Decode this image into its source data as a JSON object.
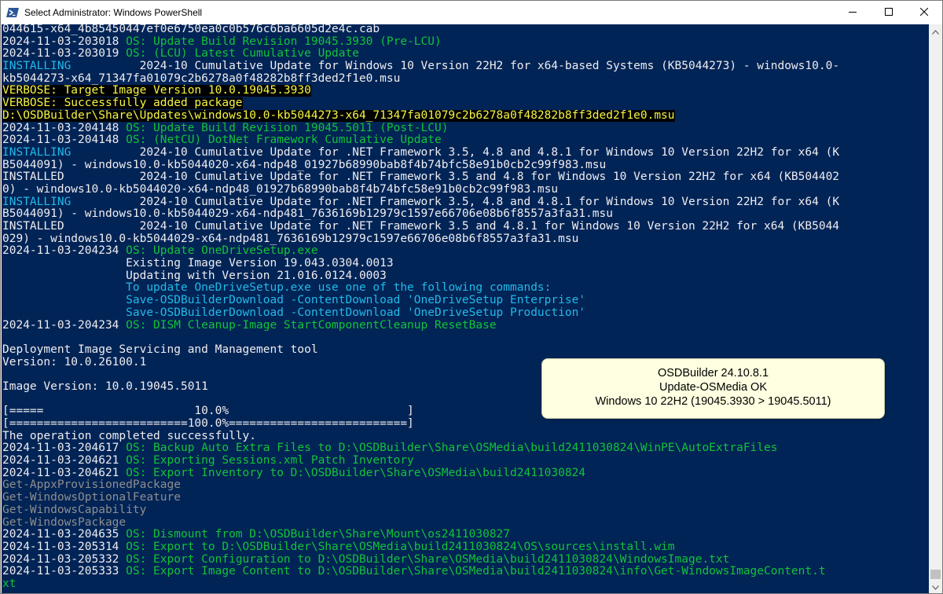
{
  "window": {
    "title": "Select Administrator: Windows PowerShell",
    "icon": "powershell-icon",
    "controls": [
      "minimize-icon",
      "maximize-icon",
      "close-icon"
    ]
  },
  "colors": {
    "console_bg": "#012456",
    "text_white": "#eeedf0",
    "text_green": "#13c23a",
    "text_cyan": "#23b9e8",
    "text_gray": "#8e8e8e",
    "verbose_yellow": "#f5f544",
    "verbose_bg": "#000000",
    "notification_bg": "#ffffe1"
  },
  "console": {
    "lines": [
      {
        "segments": [
          {
            "t": "044615-x64_4b85450447ef0e6750ea0c0b576c6ba6605d2e4c.cab",
            "c": "white"
          }
        ]
      },
      {
        "segments": [
          {
            "t": "2024-11-03-203018 ",
            "c": "white"
          },
          {
            "t": "OS: Update Build Revision 19045.3930 (Pre-LCU)",
            "c": "green"
          }
        ]
      },
      {
        "segments": [
          {
            "t": "2024-11-03-203019 ",
            "c": "white"
          },
          {
            "t": "OS: (LCU) Latest Cumulative Update",
            "c": "green"
          }
        ]
      },
      {
        "segments": [
          {
            "t": "INSTALLING          ",
            "c": "cyan"
          },
          {
            "t": "2024-10 Cumulative Update for Windows 10 Version 22H2 for x64-based Systems (KB5044273) - windows10.0-",
            "c": "white"
          }
        ]
      },
      {
        "segments": [
          {
            "t": "kb5044273-x64_71347fa01079c2b6278a0f48282b8ff3ded2f1e0.msu",
            "c": "white"
          }
        ]
      },
      {
        "segments": [
          {
            "t": "VERBOSE: Target Image Version 10.0.19045.3930",
            "c": "hl"
          }
        ]
      },
      {
        "segments": [
          {
            "t": "VERBOSE: Successfully added package",
            "c": "hl"
          }
        ]
      },
      {
        "segments": [
          {
            "t": "D:\\OSDBuilder\\Share\\Updates\\windows10.0-kb5044273-x64_71347fa01079c2b6278a0f48282b8ff3ded2f1e0.msu",
            "c": "hl"
          }
        ]
      },
      {
        "segments": [
          {
            "t": "2024-11-03-204148 ",
            "c": "white"
          },
          {
            "t": "OS: Update Build Revision 19045.5011 (Post-LCU)",
            "c": "green"
          }
        ]
      },
      {
        "segments": [
          {
            "t": "2024-11-03-204148 ",
            "c": "white"
          },
          {
            "t": "OS: (NetCU) DotNet Framework Cumulative Update",
            "c": "green"
          }
        ]
      },
      {
        "segments": [
          {
            "t": "INSTALLING          ",
            "c": "cyan"
          },
          {
            "t": "2024-10 Cumulative Update for .NET Framework 3.5, 4.8 and 4.8.1 for Windows 10 Version 22H2 for x64 (K",
            "c": "white"
          }
        ]
      },
      {
        "segments": [
          {
            "t": "B5044091) - windows10.0-kb5044020-x64-ndp48_01927b68990bab8f4b74bfc58e91b0cb2c99f983.msu",
            "c": "white"
          }
        ]
      },
      {
        "segments": [
          {
            "t": "INSTALLED           2024-10 Cumulative Update for .NET Framework 3.5 and 4.8 for Windows 10 Version 22H2 for x64 (KB504402",
            "c": "white"
          }
        ]
      },
      {
        "segments": [
          {
            "t": "0) - windows10.0-kb5044020-x64-ndp48_01927b68990bab8f4b74bfc58e91b0cb2c99f983.msu",
            "c": "white"
          }
        ]
      },
      {
        "segments": [
          {
            "t": "INSTALLING          ",
            "c": "cyan"
          },
          {
            "t": "2024-10 Cumulative Update for .NET Framework 3.5, 4.8 and 4.8.1 for Windows 10 Version 22H2 for x64 (K",
            "c": "white"
          }
        ]
      },
      {
        "segments": [
          {
            "t": "B5044091) - windows10.0-kb5044029-x64-ndp481_7636169b12979c1597e66706e08b6f8557a3fa31.msu",
            "c": "white"
          }
        ]
      },
      {
        "segments": [
          {
            "t": "INSTALLED           2024-10 Cumulative Update for .NET Framework 3.5 and 4.8.1 for Windows 10 Version 22H2 for x64 (KB5044",
            "c": "white"
          }
        ]
      },
      {
        "segments": [
          {
            "t": "029) - windows10.0-kb5044029-x64-ndp481_7636169b12979c1597e66706e08b6f8557a3fa31.msu",
            "c": "white"
          }
        ]
      },
      {
        "segments": [
          {
            "t": "2024-11-03-204234 ",
            "c": "white"
          },
          {
            "t": "OS: Update OneDriveSetup.exe",
            "c": "green"
          }
        ]
      },
      {
        "segments": [
          {
            "t": "                  Existing Image Version 19.043.0304.0013",
            "c": "white"
          }
        ]
      },
      {
        "segments": [
          {
            "t": "                  Updating with Version 21.016.0124.0003",
            "c": "white"
          }
        ]
      },
      {
        "segments": [
          {
            "t": "                  ",
            "c": "white"
          },
          {
            "t": "To update OneDriveSetup.exe use one of the following commands:",
            "c": "cyan"
          }
        ]
      },
      {
        "segments": [
          {
            "t": "                  ",
            "c": "white"
          },
          {
            "t": "Save-OSDBuilderDownload -ContentDownload 'OneDriveSetup Enterprise'",
            "c": "cyan"
          }
        ]
      },
      {
        "segments": [
          {
            "t": "                  ",
            "c": "white"
          },
          {
            "t": "Save-OSDBuilderDownload -ContentDownload 'OneDriveSetup Production'",
            "c": "cyan"
          }
        ]
      },
      {
        "segments": [
          {
            "t": "2024-11-03-204234 ",
            "c": "white"
          },
          {
            "t": "OS: DISM Cleanup-Image StartComponentCleanup ResetBase",
            "c": "green"
          }
        ]
      },
      {
        "segments": [
          {
            "t": "",
            "c": "white"
          }
        ]
      },
      {
        "segments": [
          {
            "t": "Deployment Image Servicing and Management tool",
            "c": "white"
          }
        ]
      },
      {
        "segments": [
          {
            "t": "Version: 10.0.26100.1",
            "c": "white"
          }
        ]
      },
      {
        "segments": [
          {
            "t": "",
            "c": "white"
          }
        ]
      },
      {
        "segments": [
          {
            "t": "Image Version: 10.0.19045.5011",
            "c": "white"
          }
        ]
      },
      {
        "segments": [
          {
            "t": "",
            "c": "white"
          }
        ]
      },
      {
        "segments": [
          {
            "t": "[=====                      10.0%                          ]",
            "c": "white"
          }
        ]
      },
      {
        "segments": [
          {
            "t": "[==========================100.0%==========================]",
            "c": "white"
          }
        ]
      },
      {
        "segments": [
          {
            "t": "The operation completed successfully.",
            "c": "white"
          }
        ]
      },
      {
        "segments": [
          {
            "t": "2024-11-03-204617 ",
            "c": "white"
          },
          {
            "t": "OS: Backup Auto Extra Files to D:\\OSDBuilder\\Share\\OSMedia\\build2411030824\\WinPE\\AutoExtraFiles",
            "c": "green"
          }
        ]
      },
      {
        "segments": [
          {
            "t": "2024-11-03-204621 ",
            "c": "white"
          },
          {
            "t": "OS: Exporting Sessions.xml Patch Inventory",
            "c": "green"
          }
        ]
      },
      {
        "segments": [
          {
            "t": "2024-11-03-204621 ",
            "c": "white"
          },
          {
            "t": "OS: Export Inventory to D:\\OSDBuilder\\Share\\OSMedia\\build2411030824",
            "c": "green"
          }
        ]
      },
      {
        "segments": [
          {
            "t": "Get-AppxProvisionedPackage",
            "c": "gray"
          }
        ]
      },
      {
        "segments": [
          {
            "t": "Get-WindowsOptionalFeature",
            "c": "gray"
          }
        ]
      },
      {
        "segments": [
          {
            "t": "Get-WindowsCapability",
            "c": "gray"
          }
        ]
      },
      {
        "segments": [
          {
            "t": "Get-WindowsPackage",
            "c": "gray"
          }
        ]
      },
      {
        "segments": [
          {
            "t": "2024-11-03-204635 ",
            "c": "white"
          },
          {
            "t": "OS: Dismount from D:\\OSDBuilder\\Share\\Mount\\os2411030827",
            "c": "green"
          }
        ]
      },
      {
        "segments": [
          {
            "t": "2024-11-03-205314 ",
            "c": "white"
          },
          {
            "t": "OS: Export to D:\\OSDBuilder\\Share\\OSMedia\\build2411030824\\OS\\sources\\install.wim",
            "c": "green"
          }
        ]
      },
      {
        "segments": [
          {
            "t": "2024-11-03-205332 ",
            "c": "white"
          },
          {
            "t": "OS: Export Configuration to D:\\OSDBuilder\\Share\\OSMedia\\build2411030824\\WindowsImage.txt",
            "c": "green"
          }
        ]
      },
      {
        "segments": [
          {
            "t": "2024-11-03-205333 ",
            "c": "white"
          },
          {
            "t": "OS: Export Image Content to D:\\OSDBuilder\\Share\\OSMedia\\build2411030824\\info\\Get-WindowsImageContent.t",
            "c": "green"
          }
        ]
      },
      {
        "segments": [
          {
            "t": "xt",
            "c": "green"
          }
        ]
      }
    ]
  },
  "notification": {
    "line1": "OSDBuilder 24.10.8.1",
    "line2": "Update-OSMedia OK",
    "line3": "Windows 10 22H2 (19045.3930 > 19045.5011)"
  }
}
